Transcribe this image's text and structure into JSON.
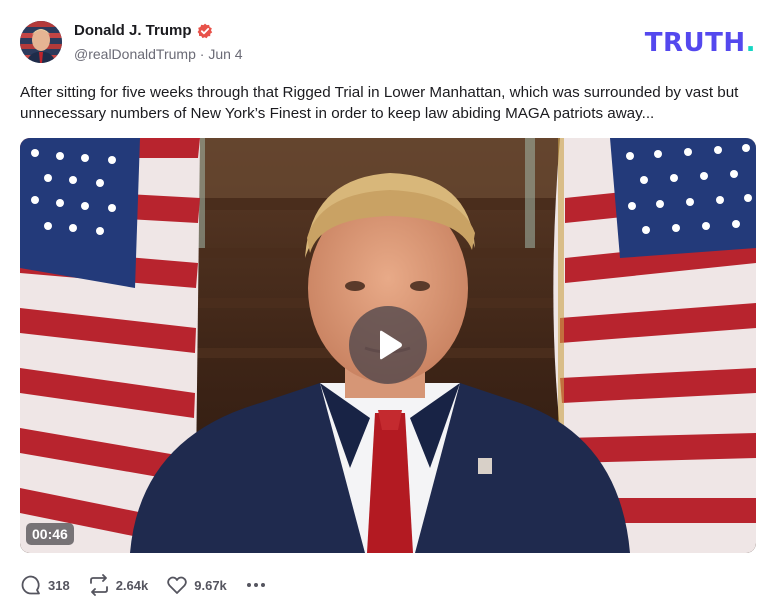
{
  "author": {
    "name": "Donald J. Trump",
    "handle": "@realDonaldTrump",
    "date": "Jun 4",
    "separator": "·",
    "verified": true
  },
  "brand": {
    "word": "TRUTH",
    "dot": ".",
    "color": "#5448ee",
    "dot_color": "#14d6c3"
  },
  "post": {
    "text": "After sitting for five weeks through that Rigged Trial in Lower Manhattan, which was surrounded by vast but unnecessary numbers of New York’s Finest in order to keep law abiding MAGA patriots away..."
  },
  "video": {
    "duration": "00:46",
    "play_icon": "play-icon"
  },
  "actions": {
    "replies": "318",
    "retruths": "2.64k",
    "likes": "9.67k",
    "more_icon": "more-icon"
  },
  "colors": {
    "text": "#1b1b1f",
    "muted": "#6b6b76",
    "verified": "#e8524a"
  }
}
